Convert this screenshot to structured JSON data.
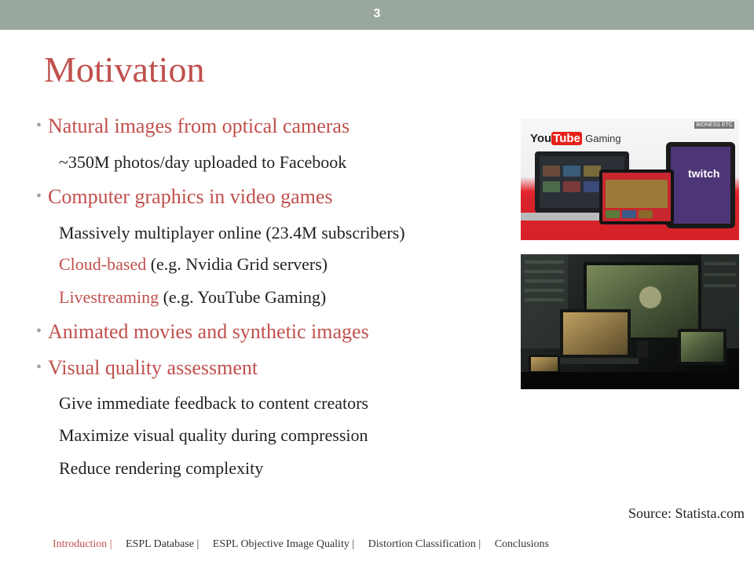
{
  "slide_number": "3",
  "title": "Motivation",
  "bullets": [
    {
      "text": "Natural images from optical cameras"
    },
    {
      "text": "Computer graphics in video games"
    },
    {
      "text": "Animated movies and synthetic images"
    },
    {
      "text": "Visual quality assessment"
    }
  ],
  "subs": {
    "photos": "~350M photos/day uploaded to Facebook",
    "mmo": "Massively multiplayer online (23.4M subscribers)",
    "cloud_hl": "Cloud-based",
    "cloud_rest": " (e.g. Nvidia Grid servers)",
    "live_hl": "Livestreaming",
    "live_rest": " (e.g. YouTube Gaming)",
    "feedback": "Give immediate feedback to content creators",
    "maximize": "Maximize visual quality during compression",
    "reduce": "Reduce rendering complexity"
  },
  "image1": {
    "youtube": "You",
    "tube": "Tube",
    "gaming": "Gaming",
    "twitch": "twitch",
    "badge": "BIDNESS ETC"
  },
  "source": "Source: Statista.com",
  "footer": {
    "items": [
      "Introduction |",
      "ESPL Database |",
      "ESPL Objective Image Quality |",
      "Distortion Classification |",
      "Conclusions"
    ]
  },
  "colors": {
    "accent": "#c0504d",
    "bar": "#9aa79c"
  }
}
